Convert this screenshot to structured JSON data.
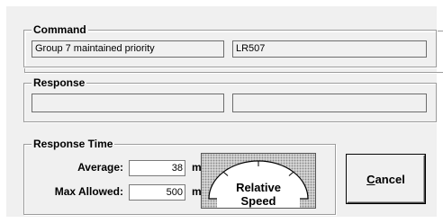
{
  "command": {
    "title": "Command",
    "description": "Group 7 maintained priority",
    "code": "LR507"
  },
  "response": {
    "title": "Response",
    "field1": "",
    "field2": ""
  },
  "response_time": {
    "title": "Response Time",
    "average_label": "Average:",
    "average_value": "38",
    "average_unit": "ms",
    "max_label": "Max Allowed:",
    "max_value": "500",
    "max_unit": "ms",
    "gauge_label": "Relative Speed",
    "gauge_fraction": 0.076
  },
  "buttons": {
    "cancel_accel": "C",
    "cancel_rest": "ancel"
  }
}
